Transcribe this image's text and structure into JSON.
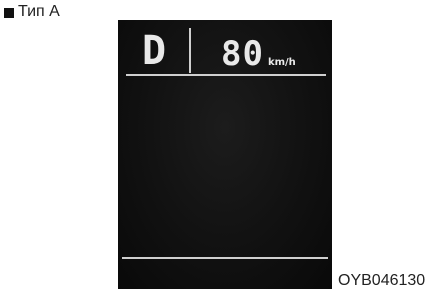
{
  "caption": {
    "type_label": "Тип A"
  },
  "display": {
    "gear": "D",
    "speed": "80",
    "unit": "km/h"
  },
  "figure_code": "OYB046130",
  "icons": {
    "bullet": "black-square-icon"
  },
  "colors": {
    "display_background": "#111111",
    "display_text": "#e9e9e9",
    "divider_lines": "#cfcfcf"
  }
}
